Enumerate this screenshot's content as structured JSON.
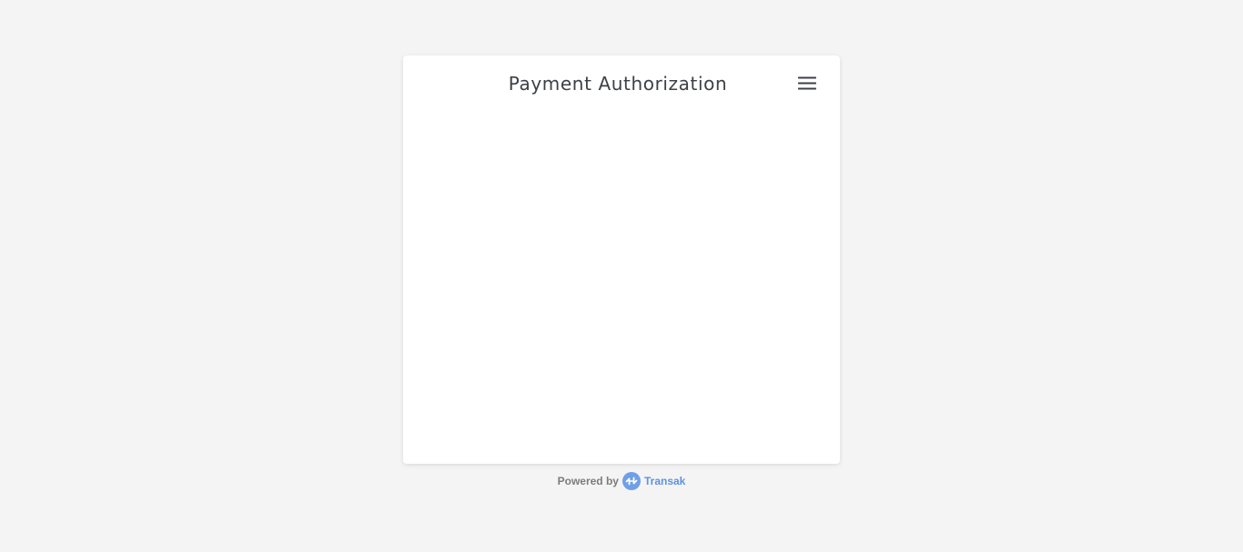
{
  "card": {
    "title": "Payment Authorization",
    "menu_icon": "hamburger-menu-icon"
  },
  "footer": {
    "powered_by_label": "Powered by",
    "brand_logo_icon": "transak-logo-icon",
    "brand_name": "Transak"
  },
  "colors": {
    "background": "#f4f4f4",
    "card": "#ffffff",
    "title": "#3c4145",
    "brand_accent": "#5e92e3"
  }
}
